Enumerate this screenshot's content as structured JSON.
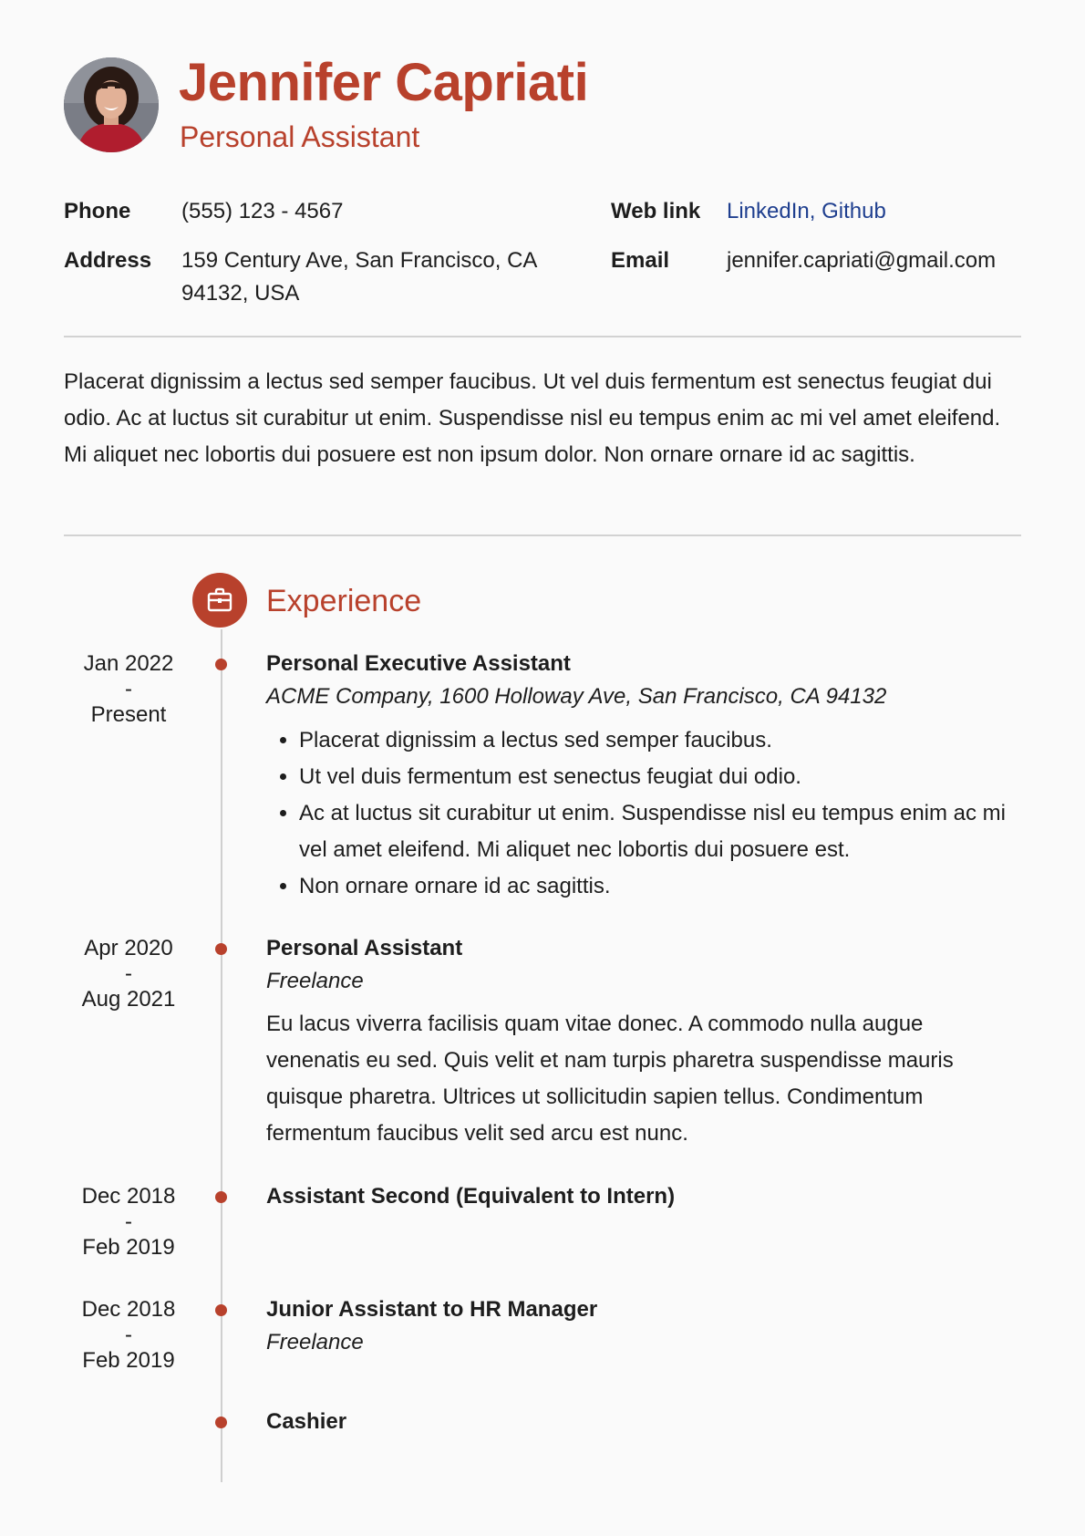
{
  "colors": {
    "accent": "#b8412c",
    "link": "#1f3f8f",
    "text": "#1d1d1d"
  },
  "header": {
    "name": "Jennifer Capriati",
    "title": "Personal Assistant"
  },
  "contact": {
    "phone_label": "Phone",
    "phone": "(555) 123 - 4567",
    "address_label": "Address",
    "address_line1": "159 Century Ave, San Francisco, CA",
    "address_line2": "94132, USA",
    "weblink_label": "Web link",
    "weblinks": "LinkedIn, Github",
    "email_label": "Email",
    "email": "jennifer.capriati@gmail.com"
  },
  "summary": "Placerat dignissim a lectus sed semper faucibus. Ut vel duis fermentum est senectus feugiat dui odio. Ac at luctus sit curabitur ut enim. Suspendisse nisl eu tempus enim ac mi vel amet eleifend. Mi aliquet nec lobortis dui posuere est non ipsum dolor. Non ornare ornare id ac sagittis.",
  "experience": {
    "section_title": "Experience",
    "section_icon": "briefcase-icon",
    "jobs": [
      {
        "date_start": "Jan 2022",
        "date_sep": "-",
        "date_end": "Present",
        "title": "Personal Executive Assistant",
        "company": "ACME Company, 1600 Holloway Ave, San Francisco, CA 94132",
        "bullets": [
          "Placerat dignissim a lectus sed semper faucibus.",
          "Ut vel duis fermentum est senectus feugiat dui odio.",
          "Ac at luctus sit curabitur ut enim. Suspendisse nisl eu tempus enim ac mi vel amet eleifend. Mi aliquet nec lobortis dui posuere est.",
          "Non ornare ornare id ac sagittis."
        ]
      },
      {
        "date_start": "Apr 2020",
        "date_sep": "-",
        "date_end": "Aug 2021",
        "title": "Personal Assistant",
        "company": "Freelance",
        "description": "Eu lacus viverra facilisis quam vitae donec. A commodo nulla augue venenatis eu sed. Quis velit et nam turpis pharetra suspendisse mauris quisque pharetra. Ultrices ut sollicitudin sapien tellus. Condimentum fermentum faucibus velit sed arcu est nunc."
      },
      {
        "date_start": "Dec 2018",
        "date_sep": "-",
        "date_end": "Feb 2019",
        "title": "Assistant Second (Equivalent to Intern)"
      },
      {
        "date_start": "Dec 2018",
        "date_sep": "-",
        "date_end": "Feb 2019",
        "title": "Junior Assistant to HR Manager",
        "company": "Freelance"
      },
      {
        "title": "Cashier"
      }
    ]
  }
}
